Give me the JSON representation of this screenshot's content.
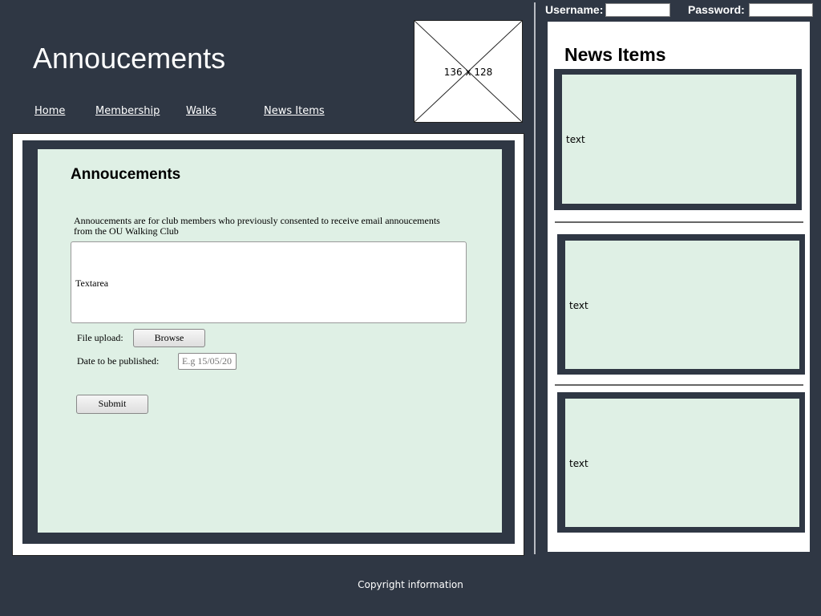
{
  "header": {
    "site_title": "Annoucements",
    "logo_placeholder": "136 x 128"
  },
  "nav": {
    "items": [
      {
        "label": "Home"
      },
      {
        "label": "Membership"
      },
      {
        "label": "Walks"
      },
      {
        "label": "News Items"
      }
    ]
  },
  "login": {
    "username_label": "Username:",
    "password_label": "Password:",
    "username_value": "",
    "password_value": ""
  },
  "main": {
    "title": "Annoucements",
    "description": "Annoucements are for club members who previously consented to receive email annoucements from the OU Walking Club",
    "textarea_value": "Textarea",
    "file_upload_label": "File upload:",
    "browse_label": "Browse",
    "date_label": "Date to be published:",
    "date_placeholder": "E.g 15/05/20",
    "submit_label": "Submit"
  },
  "sidebar": {
    "title": "News Items",
    "items": [
      {
        "text": "text"
      },
      {
        "text": "text"
      },
      {
        "text": "text"
      }
    ]
  },
  "footer": {
    "copyright": "Copyright information"
  },
  "colors": {
    "background": "#2f3744",
    "card": "#dff0e5",
    "panel": "#ffffff"
  }
}
